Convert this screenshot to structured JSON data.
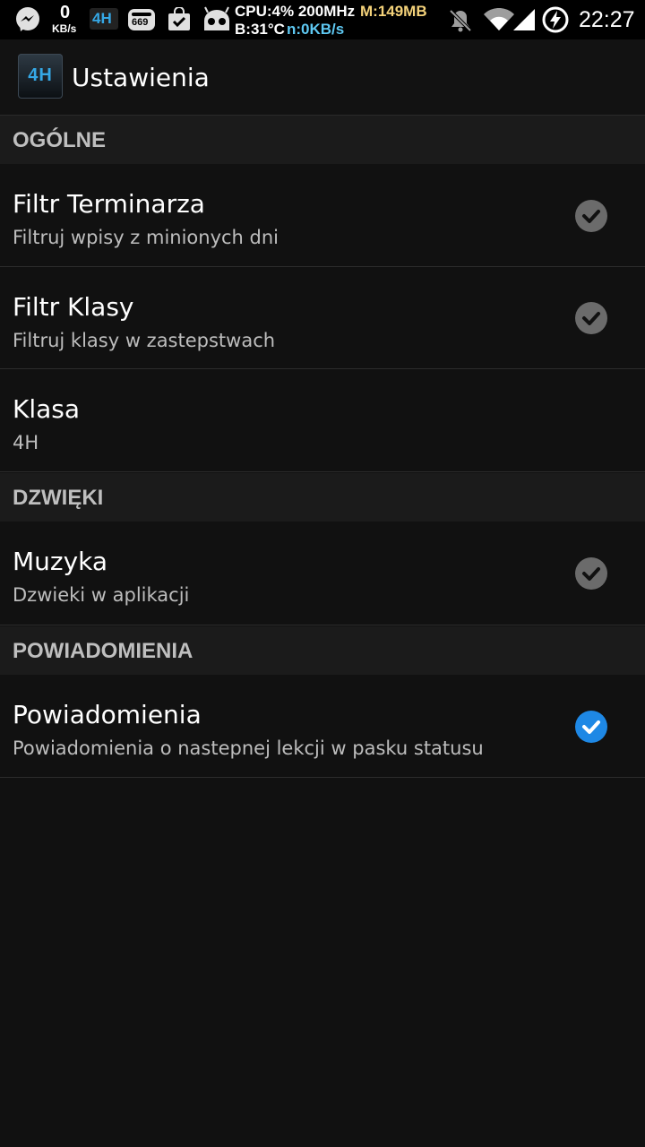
{
  "status_bar": {
    "net_speed_value": "0",
    "net_speed_unit": "KB/s",
    "app_badge": "4H",
    "counter_badge": "669",
    "cpu": "CPU:4% 200MHz",
    "mem": "M:149MB",
    "battery_temp": "B:31°C",
    "net": "n:0KB/s",
    "time": "22:27",
    "colors": {
      "cpu": "#ffffff",
      "mem": "#f4d27a",
      "net": "#5ec8f2",
      "app_badge": "#35a8e6"
    },
    "icons": [
      "messenger-icon",
      "cyanogenmod-icon",
      "store-icon",
      "android-icon",
      "bell-off-icon",
      "wifi-icon",
      "signal-icon",
      "battery-charging-icon"
    ]
  },
  "action_bar": {
    "logo_text": "4H",
    "title": "Ustawienia"
  },
  "sections": [
    {
      "header": "OGÓLNE",
      "items": [
        {
          "title": "Filtr Terminarza",
          "summary": "Filtruj wpisy z minionych dni",
          "checked": true
        },
        {
          "title": "Filtr Klasy",
          "summary": "Filtruj klasy w zastepstwach",
          "checked": true
        },
        {
          "title": "Klasa",
          "summary": "4H"
        }
      ]
    },
    {
      "header": "DZWIĘKI",
      "items": [
        {
          "title": "Muzyka",
          "summary": "Dzwieki w aplikacji",
          "checked": true
        }
      ]
    },
    {
      "header": "POWIADOMIENIA",
      "items": [
        {
          "title": "Powiadomienia",
          "summary": "Powiadomienia o nastepnej lekcji w pasku statusu",
          "checked": true,
          "highlight": true
        }
      ]
    }
  ],
  "colors": {
    "check_default": "#6b6b6b",
    "check_accent": "#1e88e5"
  }
}
